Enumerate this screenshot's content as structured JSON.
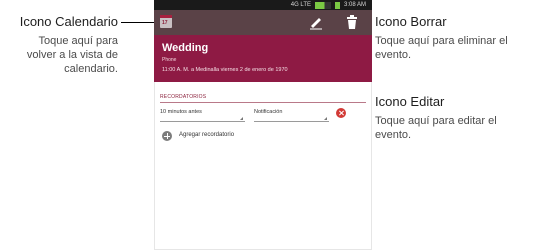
{
  "status_bar": {
    "time": "3:08 AM",
    "network": "4G LTE"
  },
  "app_bar": {
    "calendar_icon": "calendar-icon",
    "edit_icon": "pencil-icon",
    "delete_icon": "trash-icon"
  },
  "event": {
    "title": "Wedding",
    "calendar": "Phone",
    "time": "11:00 A. M. a Medinalla viernes 2 de enero de 1970"
  },
  "reminders": {
    "header": "RECORDATORIOS",
    "time_value": "10 minutos antes",
    "method_value": "Notificación",
    "add_label": "Agregar recordatorio"
  },
  "callouts": {
    "calendar": {
      "title": "Icono Calendario",
      "desc": [
        "Toque aquí para",
        "volver a la vista de",
        "calendario."
      ]
    },
    "delete": {
      "title": "Icono Borrar",
      "desc": [
        "Toque aquí para eliminar el",
        "evento."
      ]
    },
    "edit": {
      "title": "Icono Editar",
      "desc": [
        "Toque aquí para editar el",
        "evento."
      ]
    }
  },
  "colors": {
    "app_bar": "#5a4247",
    "event_header": "#8e1a44",
    "accent": "#8a1f3a",
    "remove": "#d23a36"
  }
}
